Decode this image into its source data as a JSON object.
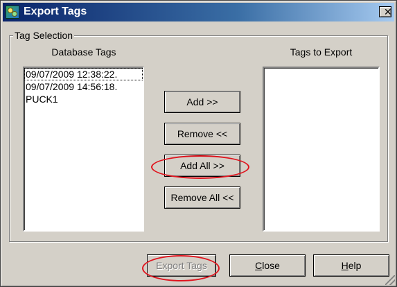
{
  "window": {
    "title": "Export Tags",
    "close_glyph": "✕"
  },
  "group": {
    "label": "Tag Selection"
  },
  "database_tags": {
    "heading": "Database Tags",
    "items": [
      "09/07/2009 12:38:22.",
      "09/07/2009 14:56:18.",
      "PUCK1"
    ]
  },
  "tags_to_export": {
    "heading": "Tags to Export",
    "items": []
  },
  "actions": {
    "add": "Add >>",
    "remove": "Remove <<",
    "add_all": "Add All >>",
    "remove_all": "Remove All <<"
  },
  "footer": {
    "export_tags": "Export Tags",
    "close_mnemonic": "C",
    "close_rest": "lose",
    "help_mnemonic": "H",
    "help_rest": "elp"
  },
  "annotation_color": "#e0141e",
  "icons": {
    "app": "export-tags-app-icon",
    "close": "close-icon",
    "resize": "resize-grip-icon"
  }
}
